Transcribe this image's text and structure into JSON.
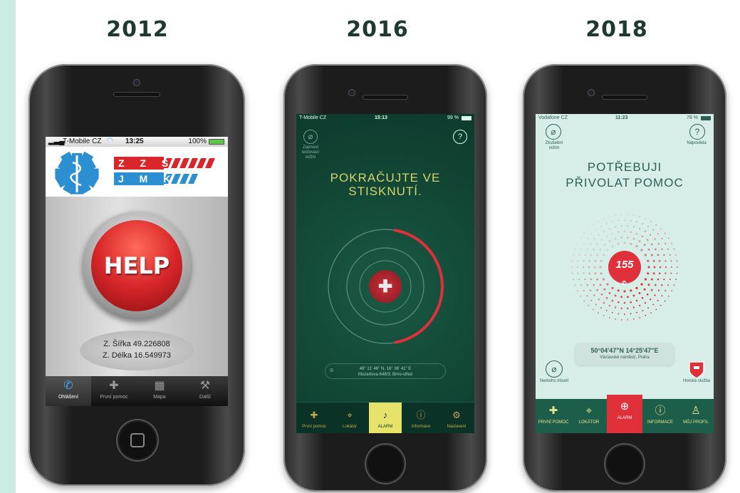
{
  "years": [
    "2012",
    "2016",
    "2018"
  ],
  "phone1": {
    "status": {
      "carrier": "T-Mobile CZ",
      "time": "13:25",
      "battery": "100%"
    },
    "logo": {
      "letters_top": "Z Z S",
      "letters_bottom": "J M K"
    },
    "help_button": "HELP",
    "coords": {
      "lat": "Z. Šířka 49.226808",
      "lon": "Z. Délka 16.549973"
    },
    "tabs": [
      {
        "label": "Ohlášení",
        "icon": "phone-icon",
        "glyph": "✆",
        "active": true
      },
      {
        "label": "První pomoc",
        "icon": "first-aid-kit-icon",
        "glyph": "✚",
        "active": false
      },
      {
        "label": "Mapa",
        "icon": "map-icon",
        "glyph": "▦",
        "active": false
      },
      {
        "label": "Další",
        "icon": "wrench-icon",
        "glyph": "⚒",
        "active": false
      }
    ]
  },
  "phone2": {
    "status": {
      "carrier": "T-Mobile CZ",
      "time": "15:13",
      "battery": "99 %"
    },
    "test_mode_label": "Zapnout testovací režim",
    "help_glyph": "?",
    "instruction": "POKRAČUJTE VE STISKNUTÍ.",
    "location": {
      "coords": "49° 11' 46\" N, 16° 36' 41\" E",
      "address": "Mozartova 648/3, Brno-střed"
    },
    "progress_fraction": 0.45,
    "tabs": [
      {
        "label": "První pomoc",
        "icon": "first-aid-kit-icon",
        "glyph": "✚",
        "active": false
      },
      {
        "label": "Lokátor",
        "icon": "crosshair-icon",
        "glyph": "⌖",
        "active": false
      },
      {
        "label": "ALARM",
        "icon": "bell-icon",
        "glyph": "♪",
        "active": true
      },
      {
        "label": "Informace",
        "icon": "info-icon",
        "glyph": "ⓘ",
        "active": false
      },
      {
        "label": "Nastavení",
        "icon": "gear-icon",
        "glyph": "⚙",
        "active": false
      }
    ]
  },
  "phone3": {
    "status": {
      "carrier": "Vodafone CZ",
      "time": "11:23",
      "battery": "78 %"
    },
    "test_mode_label": "Zkušební režim",
    "help_label": "Nápověda",
    "help_glyph": "?",
    "title_line1": "POTŘEBUJI",
    "title_line2": "PŘIVOLAT POMOC",
    "emergency_number": "155",
    "location": {
      "coords": "50°04'47\"N 14°25'47\"E",
      "address": "Václavské náměstí, Praha"
    },
    "cant_speak_label": "Nemohu mluvit",
    "mountain_service_label": "Horská služba",
    "tabs": [
      {
        "label": "PRVNÍ POMOC",
        "icon": "first-aid-kit-icon",
        "glyph": "✚",
        "active": false
      },
      {
        "label": "LOKÁTOR",
        "icon": "crosshair-icon",
        "glyph": "⌖",
        "active": false
      },
      {
        "label": "ALARM",
        "icon": "plus-circle-icon",
        "glyph": "⊕",
        "active": true
      },
      {
        "label": "INFORMACE",
        "icon": "info-icon",
        "glyph": "ⓘ",
        "active": false
      },
      {
        "label": "MŮJ PROFIL",
        "icon": "user-icon",
        "glyph": "♙",
        "active": false
      }
    ]
  },
  "colors": {
    "year_text": "#1e3a2f",
    "help_red": "#d8262a",
    "app2_green": "#134a38",
    "app2_accent": "#e7e36a",
    "app3_bg": "#d6ede8",
    "app3_red": "#e0303a",
    "ios_blue": "#3fa9f5"
  }
}
